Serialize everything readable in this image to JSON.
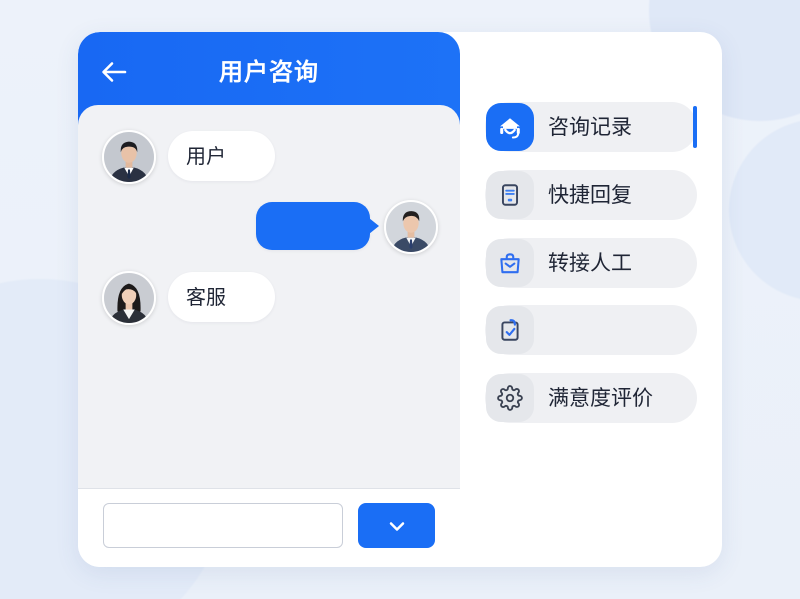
{
  "colors": {
    "accent": "#1a6ef5",
    "text": "#1f2535",
    "chat_bg": "#f1f2f5"
  },
  "chat": {
    "back_icon": "arrow-left-icon",
    "title": "用户咨询",
    "messages": [
      {
        "side": "left",
        "avatar": "male-user-avatar",
        "text": "用户"
      },
      {
        "side": "right",
        "avatar": "male-agent-avatar",
        "text": ""
      },
      {
        "side": "left",
        "avatar": "female-agent-avatar",
        "text": "客服"
      }
    ],
    "input": {
      "value": "",
      "placeholder": ""
    },
    "send_icon": "chevron-down-icon"
  },
  "menu": {
    "items": [
      {
        "label": "咨询记录",
        "icon": "headset-icon",
        "active": true
      },
      {
        "label": "快捷回复",
        "icon": "document-icon",
        "active": false
      },
      {
        "label": "转接人工",
        "icon": "transfer-bag-icon",
        "active": false
      },
      {
        "label": "",
        "icon": "checklist-icon",
        "active": false
      },
      {
        "label": "满意度评价",
        "icon": "gear-icon",
        "active": false
      }
    ]
  }
}
